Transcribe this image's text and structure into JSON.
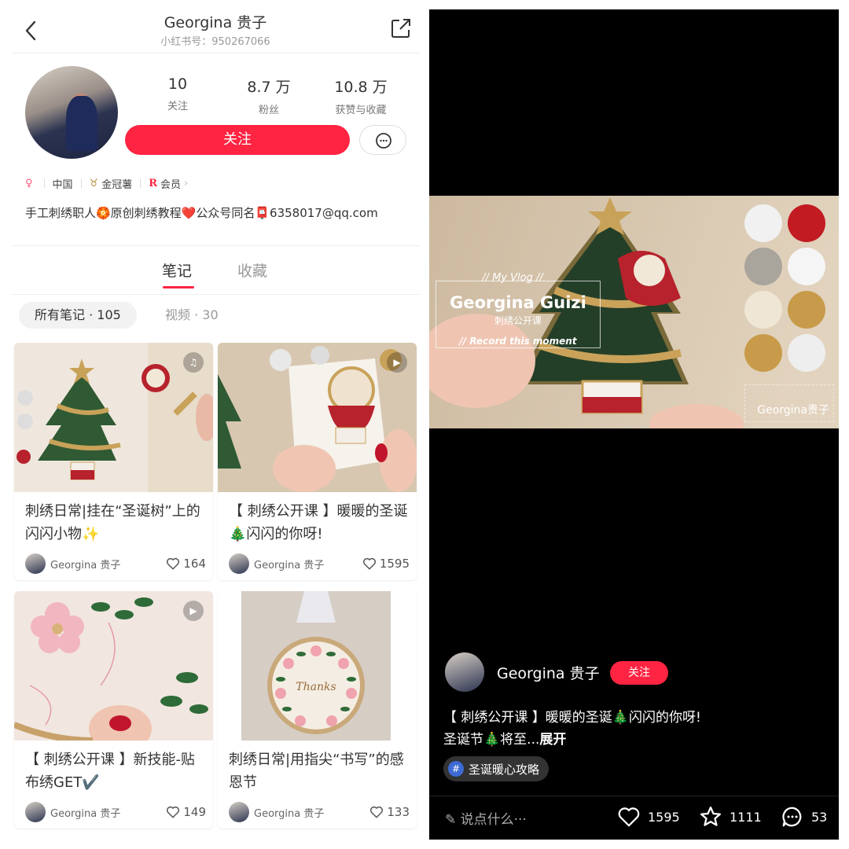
{
  "profile_header": {
    "name": "Georgina 贵子",
    "id_label": "小红书号：950267066"
  },
  "stats": [
    {
      "value": "10",
      "label": "关注"
    },
    {
      "value": "8.7 万",
      "label": "粉丝"
    },
    {
      "value": "10.8 万",
      "label": "获赞与收藏"
    }
  ],
  "follow_label": "关注",
  "tags": {
    "location": "中国",
    "award": "金冠薯",
    "member": "会员"
  },
  "bio": "手工刺绣职人🏵️原创刺绣教程❤️公众号同名📮6358017@qq.com",
  "tabs": {
    "notes": "笔记",
    "favorites": "收藏"
  },
  "filters": {
    "all_notes": "所有笔记 · 105",
    "videos": "视频 · 30"
  },
  "cards": [
    {
      "title": "刺绣日常|挂在“圣诞树”上的闪闪小物✨",
      "author": "Georgina 贵子",
      "likes": "164",
      "badge": "music-icon"
    },
    {
      "title": "【 刺绣公开课 】暖暖的圣诞🎄闪闪的你呀!",
      "author": "Georgina 贵子",
      "likes": "1595",
      "badge": "play-icon"
    },
    {
      "title": "【 刺绣公开课 】新技能-贴布绣GET✔️",
      "author": "Georgina 贵子",
      "likes": "149",
      "badge": "play-icon"
    },
    {
      "title": "刺绣日常|用指尖“书写”的感恩节",
      "author": "Georgina 贵子",
      "likes": "133",
      "badge": ""
    }
  ],
  "video": {
    "my_vlog": "// My Vlog //",
    "title": "Georgina Guizi",
    "subtitle": "刺绣公开课",
    "record": "// Record this moment",
    "watermark": "Georgina贵子"
  },
  "post": {
    "author": "Georgina 贵子",
    "follow_label": "关注",
    "desc_line1": "【 刺绣公开课 】暖暖的圣诞🎄闪闪的你呀!",
    "desc_line2": "圣诞节🎄将至...",
    "more_label": "展开",
    "topic": "圣诞暖心攻略",
    "comment_placeholder": "说点什么···",
    "likes": "1595",
    "collects": "1111",
    "comments": "53"
  },
  "colors": {
    "brand_red": "#ff2442",
    "topic_blue": "#3d6bd6"
  }
}
